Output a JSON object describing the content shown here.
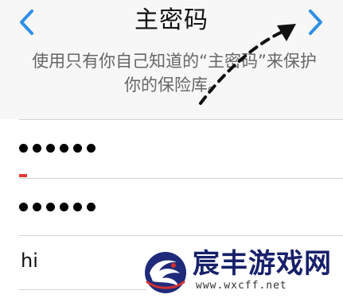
{
  "header": {
    "title": "主密码",
    "back_icon": "chevron-left-icon",
    "next_icon": "chevron-right-icon"
  },
  "description": {
    "line1": "使用只有你自己知道的“主密码”来保护",
    "line2": "你的保险库。"
  },
  "form": {
    "password": {
      "masked_value": "••••••"
    },
    "confirm_password": {
      "masked_value": "••••••"
    },
    "hint": {
      "value": "hi"
    }
  },
  "colors": {
    "accent": "#2f8fe6",
    "cursor": "#e53935",
    "annotation_arrow": "#111111"
  },
  "watermark": {
    "brand": "宸丰游戏网",
    "url": "www.wxcff.net"
  }
}
